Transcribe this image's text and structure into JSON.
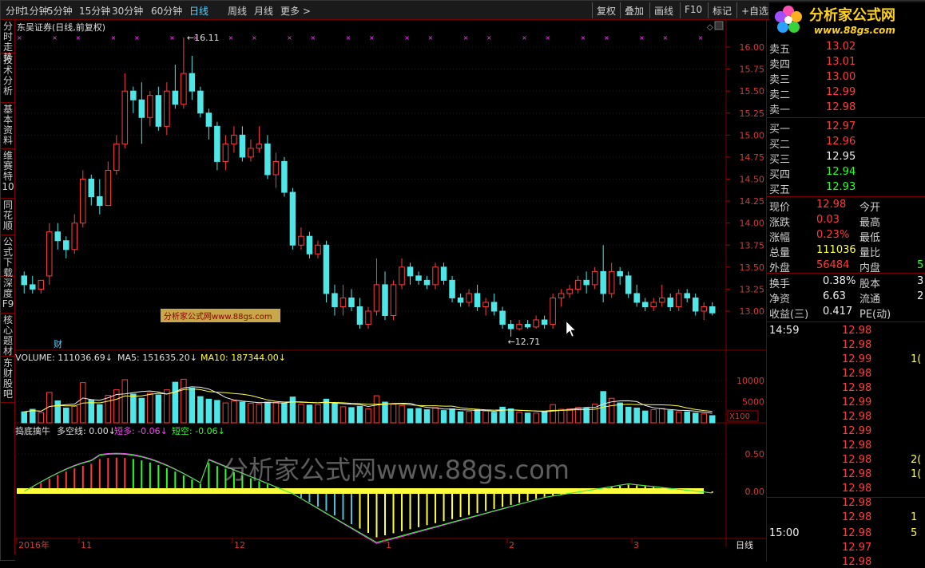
{
  "toolbar": {
    "left": [
      "分时",
      "1分钟",
      "5分钟",
      "15分钟",
      "30分钟",
      "60分钟",
      "日线",
      "周线",
      "月线",
      "更多 >"
    ],
    "active_index": 6,
    "right": [
      "复权",
      "叠加",
      "画线",
      "F10",
      "标记",
      "+自选"
    ]
  },
  "sidebar": [
    "分时走势",
    "技术分析",
    "基本资料",
    "维赛特10",
    "同花顺",
    "公式下载",
    "深度F9",
    "核心题材",
    "东财股吧"
  ],
  "logo": {
    "text": "分析家公式网",
    "url": "www.88gs.com"
  },
  "chart": {
    "title": "东吴证券(日线,前复权)",
    "high_label": "16.11",
    "low_label": "12.71",
    "price_axis": [
      "16.00",
      "15.75",
      "15.50",
      "15.25",
      "15.00",
      "14.75",
      "14.50",
      "14.25",
      "14.00",
      "13.75",
      "13.50",
      "13.25",
      "13.00"
    ],
    "watermark_box": "分析家公式网www.88gs.com",
    "cai_label": "财",
    "volume_header": {
      "vol": "VOLUME: 111036.69",
      "ma5": "MA5: 151635.20",
      "ma10": "MA10: 187344.00"
    },
    "volume_axis": [
      "10000",
      "5000"
    ],
    "volume_unit": "X100",
    "indicator_header": {
      "name": "捣底擒牛",
      "dkx": "多空线: 0.00",
      "dd": "短多: -0.06",
      "dk": "短空: -0.06"
    },
    "indicator_axis": [
      "0.50",
      "0.00"
    ],
    "big_watermark": "分析家公式网www.88gs.com",
    "date_axis": [
      "2016年",
      "11",
      "12",
      "1",
      "2",
      "3"
    ],
    "period_label": "日线",
    "colors": {
      "up": "#ff3b3b",
      "down": "#4ee6e6",
      "grid": "#7a0000",
      "ma5": "#f0f0f0",
      "ma10": "#ffff3b"
    }
  },
  "quotes": {
    "sell": [
      {
        "l": "卖五",
        "p": "13.02"
      },
      {
        "l": "卖四",
        "p": "13.01"
      },
      {
        "l": "卖三",
        "p": "13.00"
      },
      {
        "l": "卖二",
        "p": "12.99"
      },
      {
        "l": "卖一",
        "p": "12.98"
      }
    ],
    "buy": [
      {
        "l": "买一",
        "p": "12.97"
      },
      {
        "l": "买二",
        "p": "12.96"
      },
      {
        "l": "买三",
        "p": "12.95"
      },
      {
        "l": "买四",
        "p": "12.94"
      },
      {
        "l": "买五",
        "p": "12.93"
      }
    ],
    "stats": [
      {
        "l": "现价",
        "v": "12.98",
        "l2": "今开"
      },
      {
        "l": "涨跌",
        "v": "0.03",
        "l2": "最高"
      },
      {
        "l": "涨幅",
        "v": "0.23%",
        "l2": "最低"
      },
      {
        "l": "总量",
        "v": "111036",
        "l2": "量比"
      },
      {
        "l": "外盘",
        "v": "56484",
        "l2": "内盘",
        "v2": "5"
      }
    ],
    "stats2": [
      {
        "l": "换手",
        "v": "0.38%",
        "l2": "股本",
        "v2": "3"
      },
      {
        "l": "净资",
        "v": "6.63",
        "l2": "流通",
        "v2": "2"
      },
      {
        "l": "收益(三)",
        "v": "0.417",
        "l2": "PE(动)"
      }
    ],
    "ticks": [
      {
        "t": "14:59",
        "p": "12.98",
        "v": ""
      },
      {
        "t": "",
        "p": "12.98",
        "v": ""
      },
      {
        "t": "",
        "p": "12.99",
        "v": "1("
      },
      {
        "t": "",
        "p": "12.98",
        "v": ""
      },
      {
        "t": "",
        "p": "12.98",
        "v": ""
      },
      {
        "t": "",
        "p": "12.99",
        "v": ""
      },
      {
        "t": "",
        "p": "12.98",
        "v": ""
      },
      {
        "t": "",
        "p": "12.99",
        "v": ""
      },
      {
        "t": "",
        "p": "12.98",
        "v": ""
      },
      {
        "t": "",
        "p": "12.98",
        "v": "2("
      },
      {
        "t": "",
        "p": "12.98",
        "v": "1("
      },
      {
        "t": "",
        "p": "12.98",
        "v": ""
      },
      {
        "t": "",
        "p": "12.98",
        "v": ""
      },
      {
        "t": "",
        "p": "12.98",
        "v": "1"
      },
      {
        "t": "15:00",
        "p": "12.98",
        "v": "5"
      },
      {
        "t": "",
        "p": "12.97",
        "v": ""
      },
      {
        "t": "",
        "p": "12.98",
        "v": ""
      }
    ]
  }
}
